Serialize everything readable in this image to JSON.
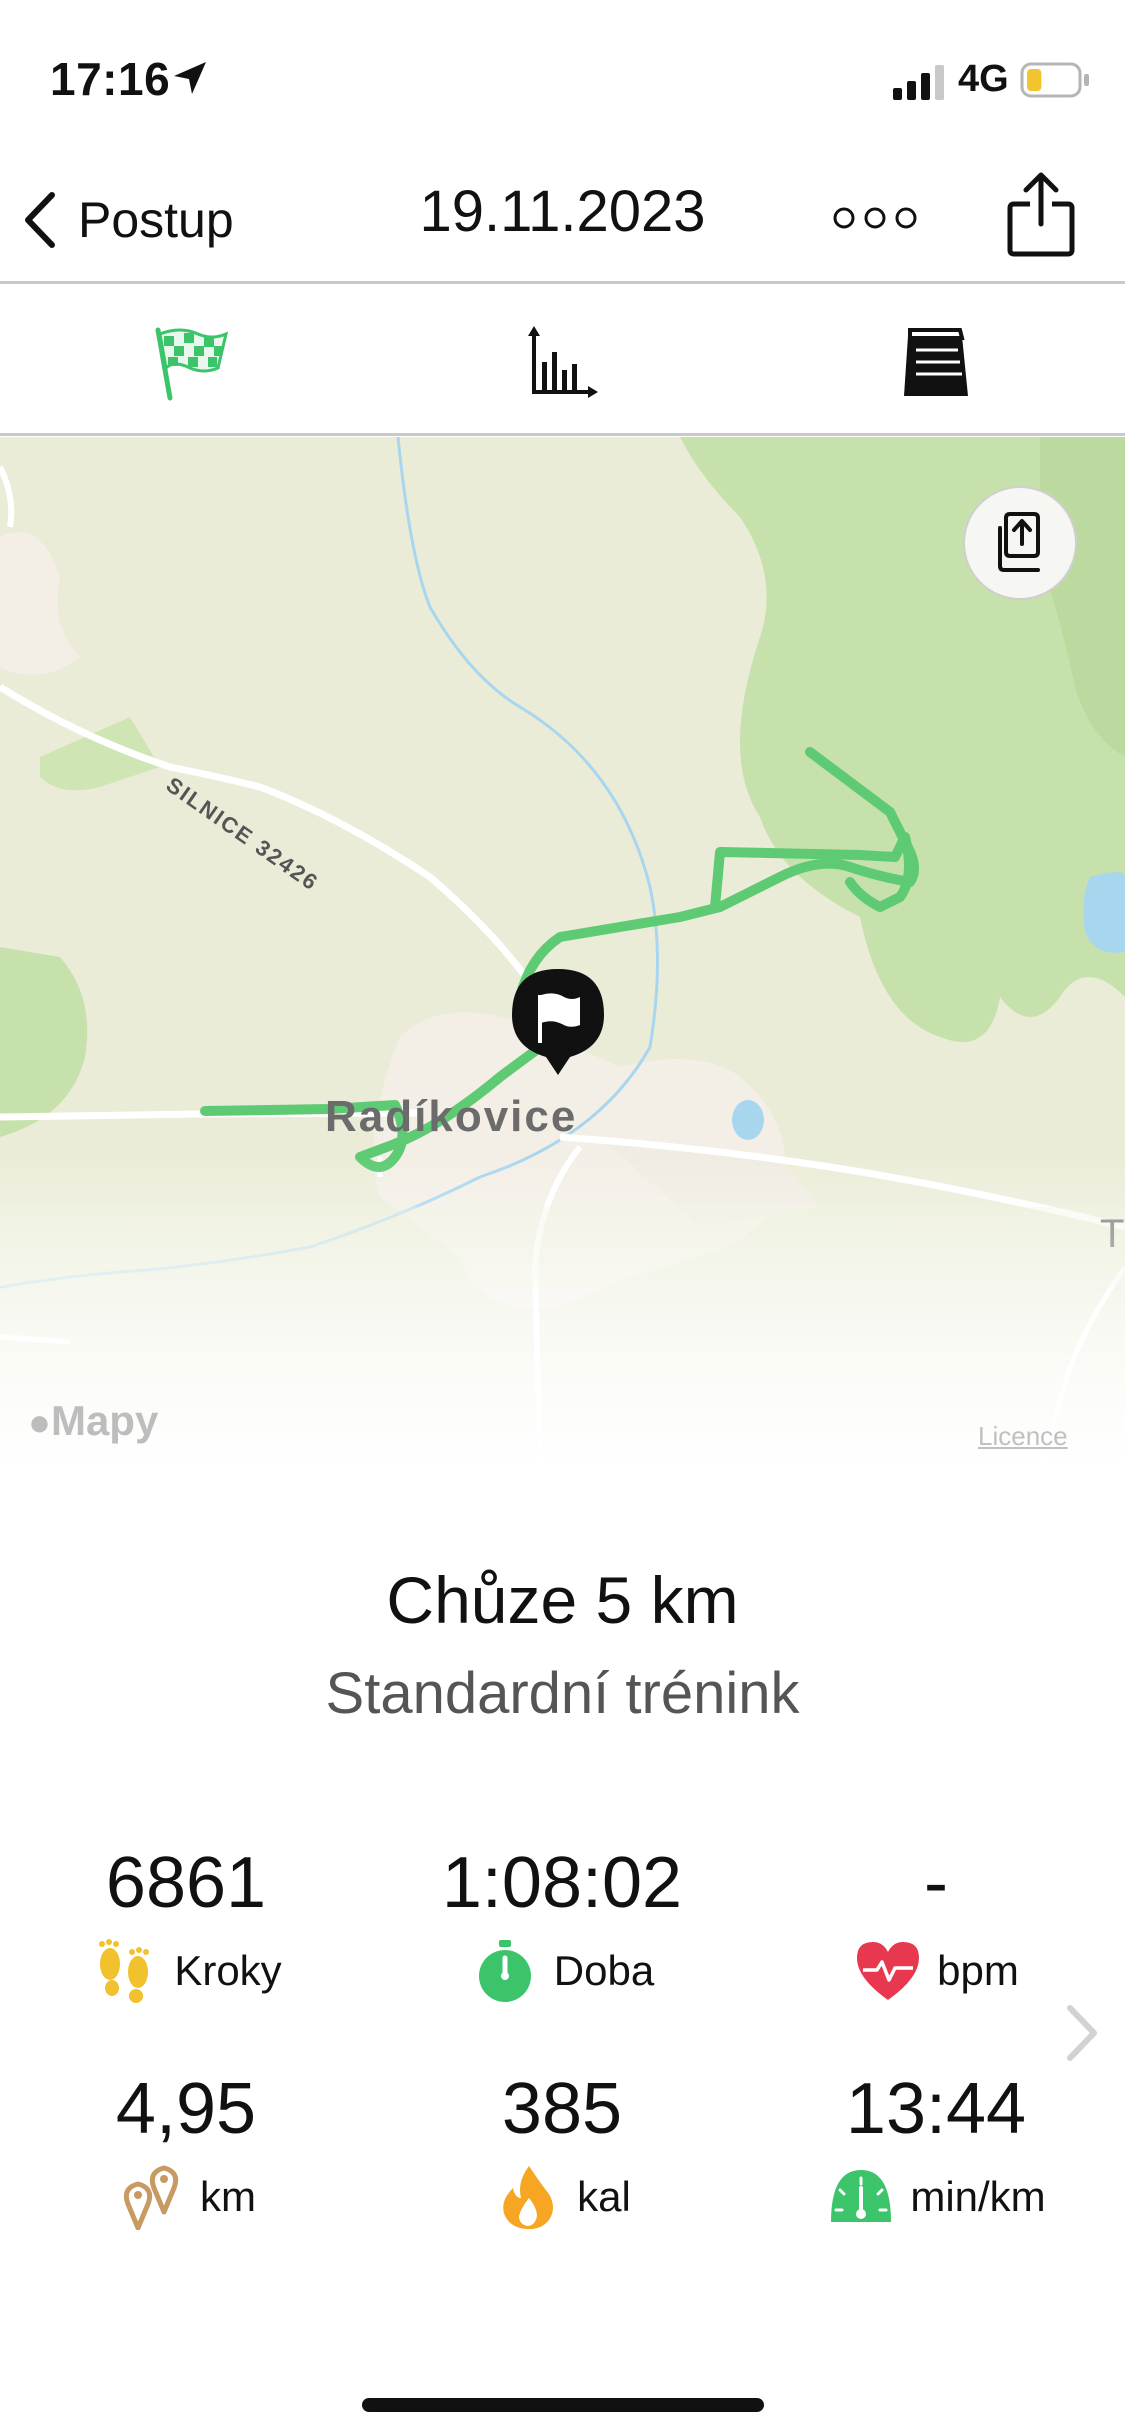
{
  "status_bar": {
    "time": "17:16",
    "network": "4G",
    "battery_level": 0.3,
    "signal_bars": 3
  },
  "nav": {
    "back_label": "Postup",
    "title": "19.11.2023",
    "more_icon": "more-dots-icon",
    "share_icon": "share-icon"
  },
  "tabs": [
    {
      "name": "route",
      "icon": "checkered-flag-icon",
      "color": "#3cc46a",
      "selected": true
    },
    {
      "name": "charts",
      "icon": "bar-chart-icon",
      "color": "#111111",
      "selected": false
    },
    {
      "name": "notes",
      "icon": "notepad-icon",
      "color": "#111111",
      "selected": false
    }
  ],
  "map": {
    "town_label": "Radíkovice",
    "road_label": "SILNICE 32426",
    "edge_label": "T",
    "logo_label": "Mapy",
    "licence_label": "Licence",
    "route_color": "#5ecb74",
    "start_marker_icon": "flag-pin-icon"
  },
  "workout": {
    "title": "Chůze 5 km",
    "subtitle": "Standardní trénink"
  },
  "stats": [
    {
      "value": "6861",
      "label": "Kroky",
      "icon": "footprints-icon"
    },
    {
      "value": "1:08:02",
      "label": "Doba",
      "icon": "stopwatch-icon"
    },
    {
      "value": "-",
      "label": "bpm",
      "icon": "heart-icon"
    },
    {
      "value": "4,95",
      "label": "km",
      "icon": "location-pins-icon"
    },
    {
      "value": "385",
      "label": "kal",
      "icon": "flame-icon"
    },
    {
      "value": "13:44",
      "label": "min/km",
      "icon": "speedometer-icon"
    }
  ],
  "colors": {
    "accent_green": "#3cc46a",
    "heart_red": "#e8384f",
    "footprint_yellow": "#f2c12e",
    "pin_brown": "#c79a62",
    "flame_orange": "#f6a623"
  }
}
